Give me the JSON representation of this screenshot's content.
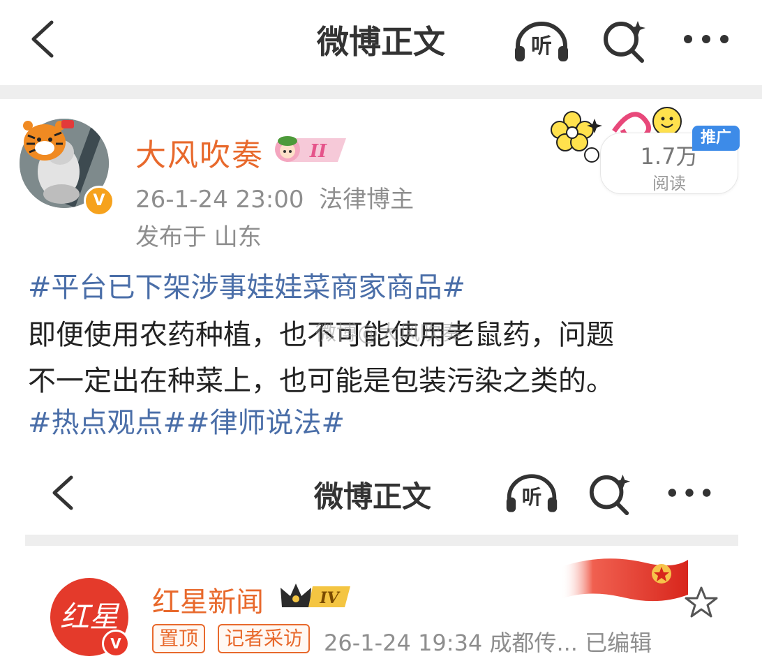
{
  "nav": {
    "title": "微博正文",
    "listen_icon_text": "听"
  },
  "post": {
    "author": "大风吹奏",
    "member_level": "II",
    "time": "26-1-24 23:00",
    "role": "法律博主",
    "location": "发布于 山东",
    "views": "1.7万",
    "views_label": "阅读",
    "promo_badge": "推广",
    "lines": [
      {
        "tag": "#平台已下架涉事娃娃菜商家商品#",
        "text": ""
      },
      {
        "tag": "",
        "text": "即便使用农药种植，也不可能使用老鼠药，问题"
      },
      {
        "tag": "",
        "text": "不一定出在种菜上，也可能是包装污染之类的。"
      },
      {
        "tag": "#热点观点##律师说法#",
        "text": ""
      }
    ],
    "watermark": "微博@大风吹奏"
  },
  "embedded": {
    "nav_title": "微博正文",
    "author": "红星新闻",
    "avatar_text": "红星",
    "member_level": "IV",
    "tag_pinned": "置顶",
    "tag_interview": "记者采访",
    "meta": "26-1-24 19:34  成都传...  已编辑"
  },
  "colors": {
    "accent_orange": "#e8692c",
    "topic_blue": "#4a6ea8",
    "promo_blue": "#3d8be8",
    "news_red": "#e43a2b"
  }
}
